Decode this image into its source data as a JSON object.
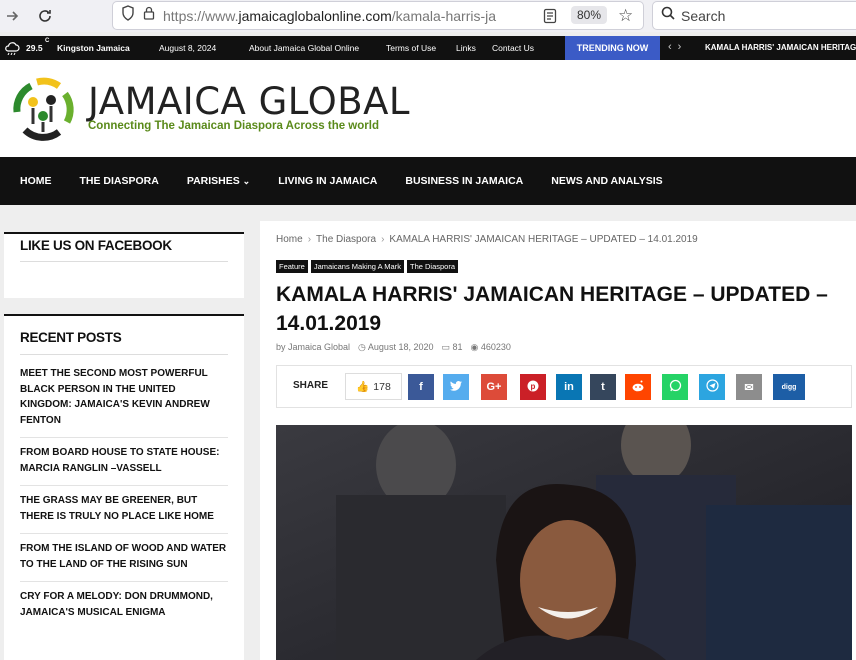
{
  "browser": {
    "url_prefix": "https://www.",
    "url_domain": "jamaicaglobalonline.com",
    "url_path": "/kamala-harris-ja",
    "zoom": "80%",
    "search_placeholder": "Search"
  },
  "topbar": {
    "temperature": "29.5",
    "temp_unit": "C",
    "location": "Kingston Jamaica",
    "date": "August 8, 2024",
    "links": [
      "About Jamaica Global Online",
      "Terms of Use",
      "Links",
      "Contact Us"
    ],
    "trending_label": "TRENDING NOW",
    "trending_item": "KAMALA HARRIS' JAMAICAN HERITAG"
  },
  "logo": {
    "title": "JAMAICA GLOBAL",
    "tagline": "Connecting The Jamaican Diaspora Across the world"
  },
  "nav": {
    "items": [
      "HOME",
      "THE DIASPORA",
      "PARISHES",
      "LIVING IN JAMAICA",
      "BUSINESS IN JAMAICA",
      "NEWS AND ANALYSIS"
    ]
  },
  "sidebar": {
    "facebook_title": "LIKE US ON FACEBOOK",
    "recent_title": "RECENT POSTS",
    "recent_posts": [
      "MEET THE SECOND MOST POWERFUL BLACK PERSON IN THE UNITED KINGDOM: JAMAICA'S KEVIN ANDREW FENTON",
      "FROM BOARD HOUSE TO STATE HOUSE: MARCIA RANGLIN –VASSELL",
      "THE GRASS MAY BE GREENER, BUT THERE IS TRULY NO PLACE LIKE HOME",
      "FROM THE ISLAND OF WOOD AND WATER TO THE LAND OF THE RISING SUN",
      "CRY FOR A MELODY: DON DRUMMOND, JAMAICA'S MUSICAL ENIGMA"
    ]
  },
  "article": {
    "breadcrumb": [
      "Home",
      "The Diaspora",
      "KAMALA HARRIS' JAMAICAN HERITAGE – UPDATED – 14.01.2019"
    ],
    "categories": [
      "Feature",
      "Jamaicans Making A Mark",
      "The Diaspora"
    ],
    "title": "KAMALA HARRIS' JAMAICAN HERITAGE – UPDATED – 14.01.2019",
    "author": "by Jamaica Global",
    "date": "August 18, 2020",
    "comments": "81",
    "views": "460230",
    "share_label": "SHARE",
    "likes": "178",
    "share_buttons": [
      {
        "name": "facebook",
        "glyph": "f",
        "color": "#3b5998"
      },
      {
        "name": "twitter",
        "glyph": "🐦",
        "color": "#55acee"
      },
      {
        "name": "google-plus",
        "glyph": "G+",
        "color": "#dd4b39"
      },
      {
        "name": "pinterest",
        "glyph": "P",
        "color": "#cb2027"
      },
      {
        "name": "linkedin",
        "glyph": "in",
        "color": "#0976b4"
      },
      {
        "name": "tumblr",
        "glyph": "t",
        "color": "#35465c"
      },
      {
        "name": "reddit",
        "glyph": "r",
        "color": "#ff4500"
      },
      {
        "name": "whatsapp",
        "glyph": "w",
        "color": "#25d366"
      },
      {
        "name": "telegram",
        "glyph": "➤",
        "color": "#2ca5e0"
      },
      {
        "name": "email",
        "glyph": "✉",
        "color": "#8d8d8d"
      },
      {
        "name": "digg",
        "glyph": "digg",
        "color": "#1d5ea6"
      }
    ]
  }
}
